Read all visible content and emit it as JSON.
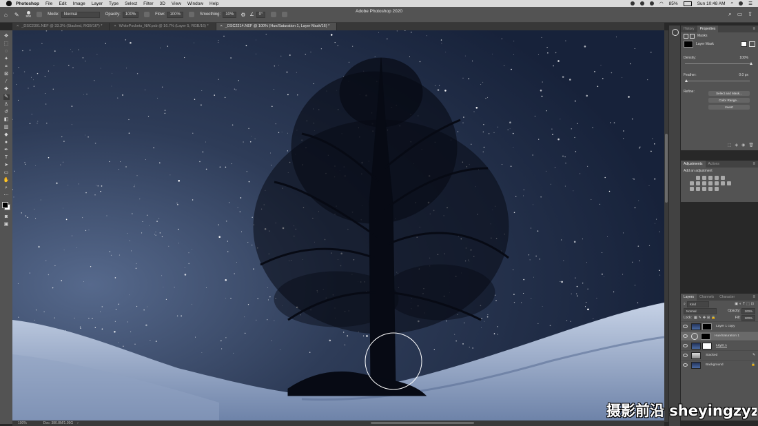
{
  "mac_menu": {
    "app_name": "Photoshop",
    "items": [
      "File",
      "Edit",
      "Image",
      "Layer",
      "Type",
      "Select",
      "Filter",
      "3D",
      "View",
      "Window",
      "Help"
    ],
    "battery": "85%",
    "clock": "Sun 10:48 AM"
  },
  "window_title": "Adobe Photoshop 2020",
  "options_bar": {
    "brush_size": "900",
    "mode_label": "Mode:",
    "mode_value": "Normal",
    "opacity_label": "Opacity:",
    "opacity_value": "100%",
    "flow_label": "Flow:",
    "flow_value": "100%",
    "smoothing_label": "Smoothing:",
    "smoothing_value": "10%",
    "angle_value": "0°"
  },
  "doc_tabs": [
    {
      "label": "_DSC2301.NEF @ 33.3% (Stacked, RGB/16*) *",
      "active": false
    },
    {
      "label": "WhitePockets_NW.psb @ 16.7% (Layer 5, RGB/16) *",
      "active": false
    },
    {
      "label": "_DSC2214.NEF @ 100% (Hue/Saturation 1, Layer Mask/16) *",
      "active": true
    }
  ],
  "status_bar": {
    "zoom": "100%",
    "doc": "Doc: 380.8M/1.05G"
  },
  "properties_panel": {
    "tabs": [
      "History",
      "Properties"
    ],
    "section_label": "Masks",
    "mask_type": "Layer Mask",
    "density_label": "Density:",
    "density_value": "100%",
    "density_level": 1.0,
    "feather_label": "Feather:",
    "feather_value": "0.0 px",
    "feather_level": 0.0,
    "refine_label": "Refine:",
    "buttons": [
      "Select and Mask...",
      "Color Range...",
      "Invert"
    ]
  },
  "adjustments_panel": {
    "tabs": [
      "Adjustments",
      "Actions"
    ],
    "hint": "Add an adjustment"
  },
  "layers_panel": {
    "tabs": [
      "Layers",
      "Channels",
      "Character"
    ],
    "filter_kind": "Kind",
    "blend_mode": "Normal",
    "opacity_label": "Opacity:",
    "opacity_value": "100%",
    "lock_label": "Lock:",
    "fill_label": "Fill:",
    "fill_value": "100%",
    "layers": [
      {
        "name": "Layer 1 copy",
        "selected": false
      },
      {
        "name": "Hue/Saturation 1",
        "selected": true
      },
      {
        "name": "Layer 1",
        "selected": false
      },
      {
        "name": "Stacked",
        "selected": false
      },
      {
        "name": "Background",
        "selected": false
      }
    ]
  },
  "watermark": "摄影前沿 sheyingzyz.com",
  "colors": {
    "panel_bg": "#535353",
    "tab_bar": "#383838",
    "sky": "#1b2536",
    "snow": "#b8c6dc",
    "tree": "#070a14"
  }
}
